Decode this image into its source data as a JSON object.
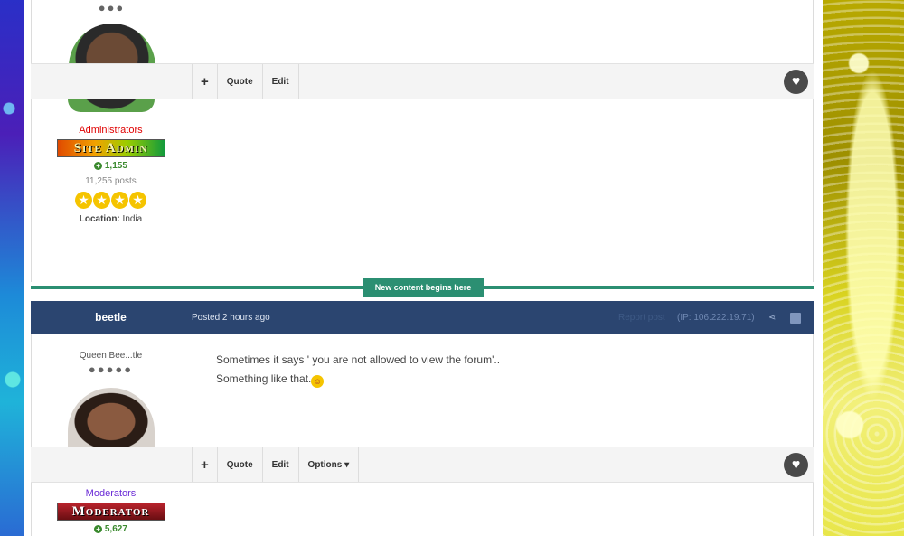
{
  "post1": {
    "group": "Administrators",
    "rank_badge": "Site Admin",
    "reputation": "1,155",
    "post_count": "11,255 posts",
    "location_label": "Location:",
    "location_value": "India",
    "star_glyph": "★",
    "actions": {
      "plus": "+",
      "quote": "Quote",
      "edit": "Edit"
    },
    "heart_glyph": "♥"
  },
  "new_content_label": "New content begins here",
  "post2": {
    "author": "beetle",
    "posted": "Posted 2 hours ago",
    "report": "Report post",
    "ip": "(IP: 106.222.19.71)",
    "share_glyph": "⋖",
    "custom_title": "Queen Bee...tle",
    "content_lines": [
      "Sometimes it says ' you are not allowed to view the forum'..",
      "Something like that."
    ],
    "emoji_glyph": "☺",
    "group": "Moderators",
    "rank_badge": "Moderator",
    "reputation": "5,627",
    "actions": {
      "plus": "+",
      "quote": "Quote",
      "edit": "Edit",
      "options": "Options ▾"
    },
    "heart_glyph": "♥"
  },
  "colors": {
    "header_bg": "#2b4570",
    "new_content": "#2b8f72",
    "admin_group": "#e00000",
    "moderator_group": "#6a2bd6",
    "reputation": "#3b8a2f"
  }
}
